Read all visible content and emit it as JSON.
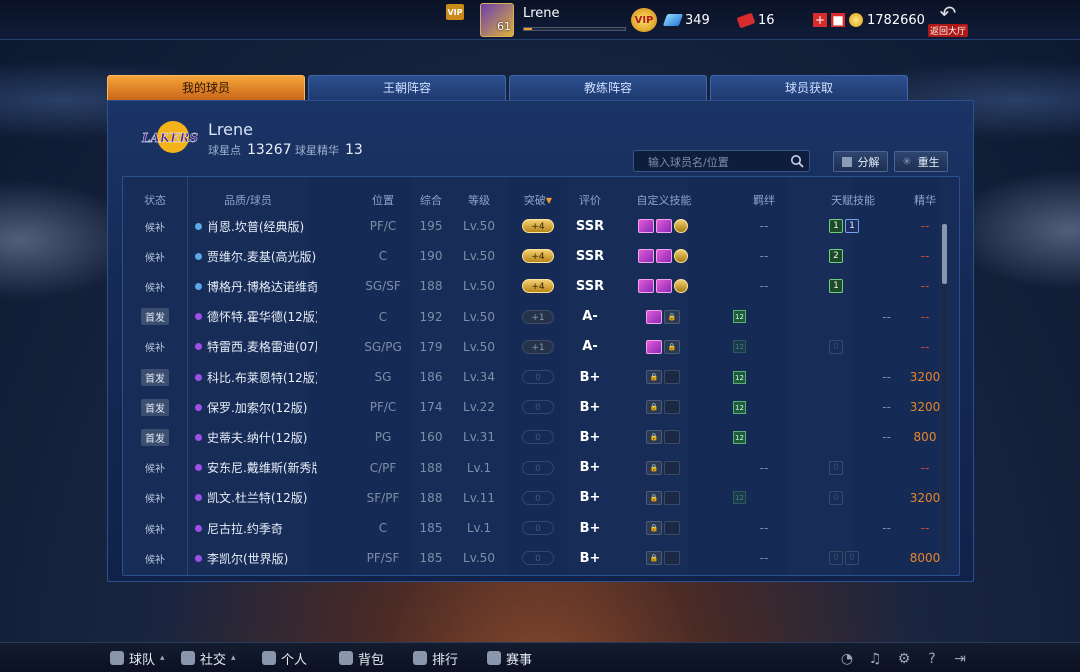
{
  "topbar": {
    "username": "Lrene",
    "level": "61",
    "xp_fraction": 0.08,
    "vip": "VIP",
    "small_vip": "VIP",
    "gems": "349",
    "tickets": "16",
    "coins": "1782660",
    "back_label": "返回大厅"
  },
  "tabs": [
    "我的球员",
    "王朝阵容",
    "教练阵容",
    "球员获取"
  ],
  "team": {
    "name": "Lrene",
    "star_points_label": "球星点",
    "star_points": "13267",
    "star_essence_label": "球星精华",
    "star_essence": "13",
    "logo_text": "LAKERS"
  },
  "search": {
    "placeholder": "输入球员名/位置"
  },
  "actions": {
    "decompose": "分解",
    "reborn": "重生"
  },
  "columns": [
    "状态",
    "品质/球员",
    "位置",
    "综合",
    "等级",
    "突破",
    "评价",
    "自定义技能",
    "羁绊",
    "天赋技能",
    "精华"
  ],
  "sort_arrow": "▼",
  "players": [
    {
      "status": "候补",
      "status_first": false,
      "quality": "#5aa9e6",
      "name": "肖恩.坎普(经典版)",
      "pos": "PF/C",
      "ovr": "195",
      "lv": "Lv.50",
      "brk": "+4",
      "brk_style": "gold",
      "grade": "SSR",
      "skills": [
        "pink",
        "pink",
        "gold"
      ],
      "bond": "--",
      "talent": [
        [
          "g",
          "1"
        ],
        [
          "b",
          "1"
        ]
      ],
      "essence": "--"
    },
    {
      "status": "候补",
      "status_first": false,
      "quality": "#5aa9e6",
      "name": "贾维尔.麦基(高光版)",
      "pos": "C",
      "ovr": "190",
      "lv": "Lv.50",
      "brk": "+4",
      "brk_style": "gold",
      "grade": "SSR",
      "skills": [
        "pink",
        "pink",
        "gold"
      ],
      "bond": "--",
      "talent": [
        [
          "g",
          "2"
        ]
      ],
      "essence": "--"
    },
    {
      "status": "候补",
      "status_first": false,
      "quality": "#5aa9e6",
      "name": "博格丹.博格达诺维奇(世界版)",
      "pos": "SG/SF",
      "ovr": "188",
      "lv": "Lv.50",
      "brk": "+4",
      "brk_style": "gold",
      "grade": "SSR",
      "skills": [
        "pink",
        "pink",
        "gold"
      ],
      "bond": "--",
      "talent": [
        [
          "g",
          "1"
        ]
      ],
      "essence": "--"
    },
    {
      "status": "首发",
      "status_first": true,
      "quality": "#a050e8",
      "name": "德怀特.霍华德(12版)",
      "pos": "C",
      "ovr": "192",
      "lv": "Lv.50",
      "brk": "+1",
      "brk_style": "dark",
      "grade": "A-",
      "skills": [
        "pink",
        "lock"
      ],
      "bond": "12",
      "talent": [],
      "talent_dash": "--",
      "essence": "--"
    },
    {
      "status": "候补",
      "status_first": false,
      "quality": "#a050e8",
      "name": "特雷西.麦格雷迪(07版)",
      "pos": "SG/PG",
      "ovr": "179",
      "lv": "Lv.50",
      "brk": "+1",
      "brk_style": "dark",
      "grade": "A-",
      "skills": [
        "pink",
        "lock"
      ],
      "bond": "12",
      "bond_dim": true,
      "talent": [
        [
          "x",
          "0"
        ]
      ],
      "essence": "--"
    },
    {
      "status": "首发",
      "status_first": true,
      "quality": "#a050e8",
      "name": "科比.布莱恩特(12版)",
      "pos": "SG",
      "ovr": "186",
      "lv": "Lv.34",
      "brk": "0",
      "brk_style": "empty",
      "grade": "B+",
      "skills": [
        "lock",
        "empty"
      ],
      "bond": "12",
      "talent": [],
      "talent_dash": "--",
      "essence": "3200"
    },
    {
      "status": "首发",
      "status_first": true,
      "quality": "#a050e8",
      "name": "保罗.加索尔(12版)",
      "pos": "PF/C",
      "ovr": "174",
      "lv": "Lv.22",
      "brk": "0",
      "brk_style": "empty",
      "grade": "B+",
      "skills": [
        "lock",
        "empty"
      ],
      "bond": "12",
      "talent": [],
      "talent_dash": "--",
      "essence": "3200"
    },
    {
      "status": "首发",
      "status_first": true,
      "quality": "#a050e8",
      "name": "史蒂夫.纳什(12版)",
      "pos": "PG",
      "ovr": "160",
      "lv": "Lv.31",
      "brk": "0",
      "brk_style": "empty",
      "grade": "B+",
      "skills": [
        "lock",
        "empty"
      ],
      "bond": "12",
      "talent": [],
      "talent_dash": "--",
      "essence": "800"
    },
    {
      "status": "候补",
      "status_first": false,
      "quality": "#a050e8",
      "name": "安东尼.戴维斯(新秀版)",
      "pos": "C/PF",
      "ovr": "188",
      "lv": "Lv.1",
      "brk": "0",
      "brk_style": "empty",
      "grade": "B+",
      "skills": [
        "lock",
        "empty"
      ],
      "bond": "--",
      "talent": [
        [
          "x",
          "0"
        ]
      ],
      "essence": "--"
    },
    {
      "status": "候补",
      "status_first": false,
      "quality": "#a050e8",
      "name": "凯文.杜兰特(12版)",
      "pos": "SF/PF",
      "ovr": "188",
      "lv": "Lv.11",
      "brk": "0",
      "brk_style": "empty",
      "grade": "B+",
      "skills": [
        "lock",
        "empty"
      ],
      "bond": "12",
      "bond_dim": true,
      "talent": [
        [
          "x",
          "0"
        ]
      ],
      "essence": "3200"
    },
    {
      "status": "候补",
      "status_first": false,
      "quality": "#a050e8",
      "name": "尼古拉.约季奇",
      "pos": "C",
      "ovr": "185",
      "lv": "Lv.1",
      "brk": "0",
      "brk_style": "empty",
      "grade": "B+",
      "skills": [
        "lock",
        "empty"
      ],
      "bond": "--",
      "talent": [],
      "talent_dash": "--",
      "essence": "--"
    },
    {
      "status": "候补",
      "status_first": false,
      "quality": "#a050e8",
      "name": "李凯尔(世界版)",
      "pos": "PF/SF",
      "ovr": "185",
      "lv": "Lv.50",
      "brk": "0",
      "brk_style": "empty",
      "grade": "B+",
      "skills": [
        "lock",
        "empty"
      ],
      "bond": "--",
      "talent": [
        [
          "x",
          "0"
        ],
        [
          "x",
          "0"
        ]
      ],
      "essence": "8000"
    }
  ],
  "bottom_nav": [
    {
      "label": "球队",
      "icon": "person-icon",
      "caret": true
    },
    {
      "label": "社交",
      "icon": "heart-icon",
      "caret": true
    },
    {
      "label": "个人",
      "icon": "user-icon",
      "caret": false
    },
    {
      "label": "背包",
      "icon": "bag-icon",
      "caret": false
    },
    {
      "label": "排行",
      "icon": "ranking-icon",
      "caret": false
    },
    {
      "label": "赛事",
      "icon": "trophy-icon",
      "caret": false
    }
  ],
  "system_icons": [
    "headset-icon",
    "music-icon",
    "settings-icon",
    "help-icon",
    "exit-icon"
  ]
}
